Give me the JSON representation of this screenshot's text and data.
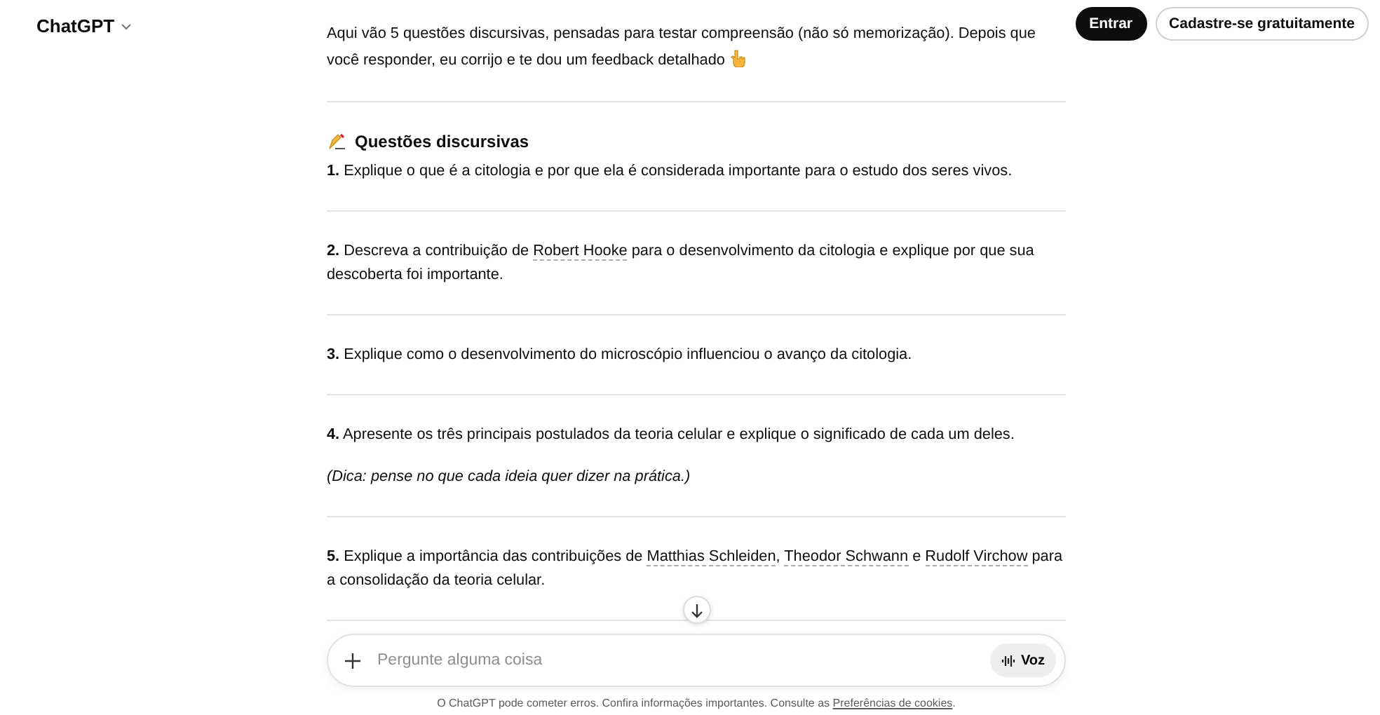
{
  "header": {
    "brand": "ChatGPT",
    "buttons": [
      {
        "label": "Entrar",
        "kind": "primary"
      },
      {
        "label": "Cadastre-se gratuitamente",
        "kind": "outline"
      }
    ]
  },
  "message": {
    "intro": "Aqui vão 5 questões discursivas, pensadas para testar compreensão (não só memorização). Depois que você responder, eu corrijo e te dou um feedback detalhado",
    "heading": "Questões discursivas",
    "questions": [
      {
        "number": "1.",
        "parts": [
          {
            "text": "Explique o que é a citologia e por que ela é considerada importante para o estudo dos seres vivos.",
            "link": false
          }
        ]
      },
      {
        "number": "2.",
        "parts": [
          {
            "text": "Descreva a contribuição de ",
            "link": false
          },
          {
            "text": "Robert Hooke",
            "link": true
          },
          {
            "text": " para o desenvolvimento da citologia e explique por que sua descoberta foi importante.",
            "link": false
          }
        ]
      },
      {
        "number": "3.",
        "parts": [
          {
            "text": "Explique como o desenvolvimento do microscópio influenciou o avanço da citologia.",
            "link": false
          }
        ]
      },
      {
        "number": "4.",
        "parts": [
          {
            "text": "Apresente os três principais postulados da teoria celular e explique o significado de cada um deles.",
            "link": false
          }
        ],
        "hint": "(Dica: pense no que cada ideia quer dizer na prática.)"
      },
      {
        "number": "5.",
        "parts": [
          {
            "text": "Explique a importância das contribuições de ",
            "link": false
          },
          {
            "text": "Matthias Schleiden",
            "link": true
          },
          {
            "text": ", ",
            "link": false
          },
          {
            "text": "Theodor Schwann",
            "link": true
          },
          {
            "text": " e ",
            "link": false
          },
          {
            "text": "Rudolf Virchow",
            "link": true
          },
          {
            "text": " para a consolidação da teoria celular.",
            "link": false
          }
        ]
      }
    ]
  },
  "composer": {
    "placeholder": "Pergunte alguma coisa",
    "voice_label": "Voz"
  },
  "footer": {
    "text": "O ChatGPT pode cometer erros. Confira informações importantes. Consulte as ",
    "link": "Preferências de cookies",
    "end": "."
  }
}
